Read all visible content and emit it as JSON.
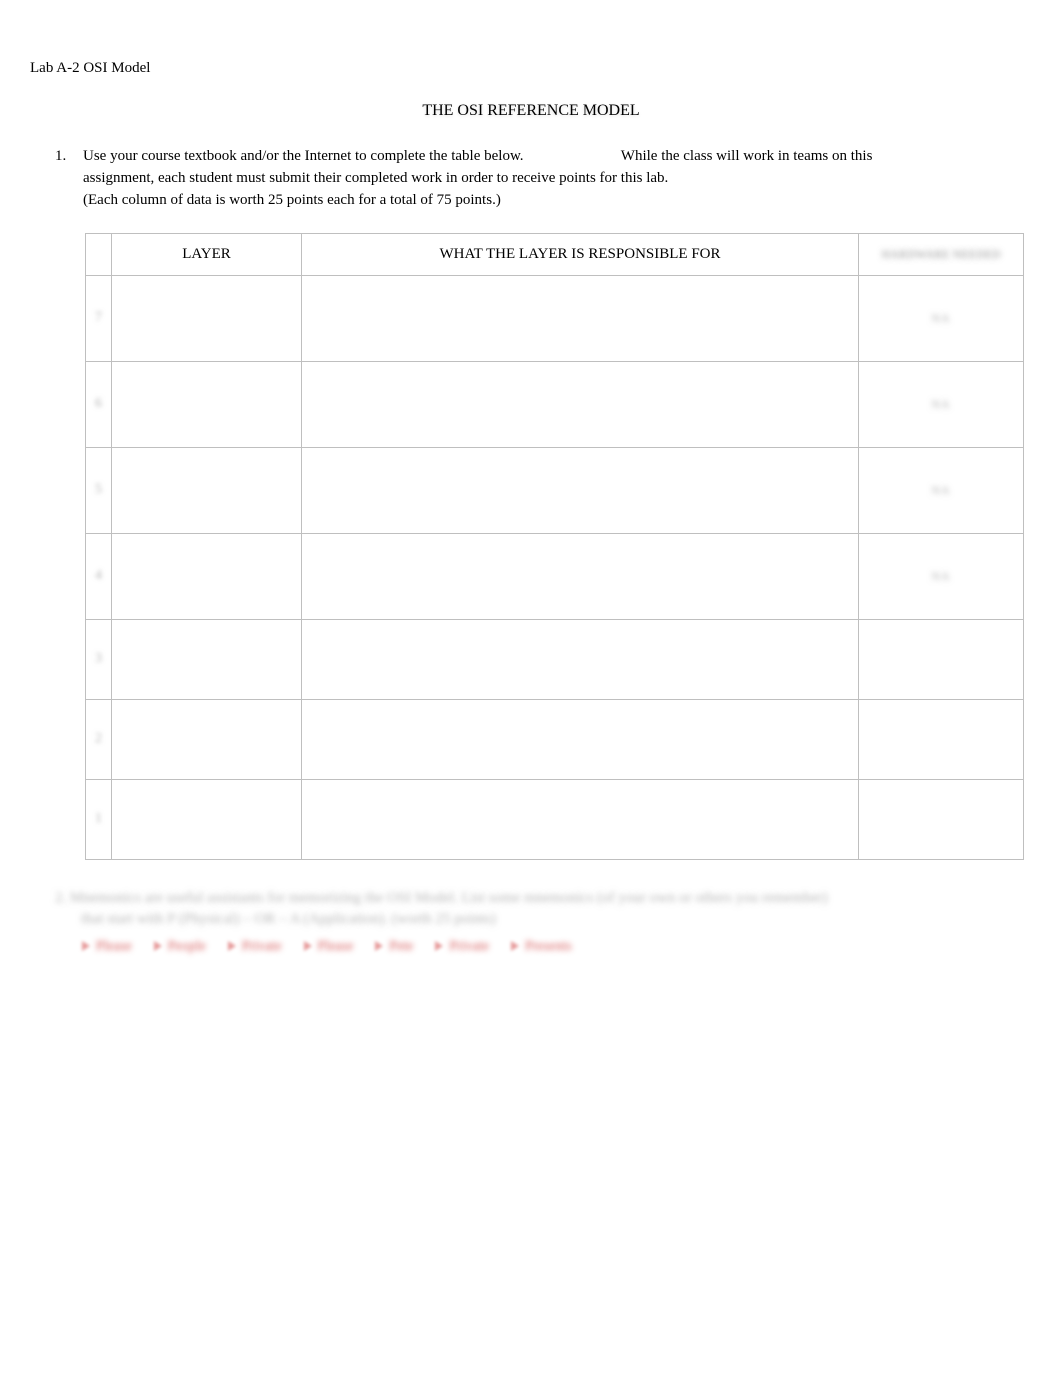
{
  "header": "Lab A-2   OSI Model",
  "title": "THE OSI REFERENCE MODEL",
  "q1": {
    "number": "1.",
    "line1a": "Use your course textbook and/or the Internet to complete the table below.",
    "line1b": "While the class will work in teams on this",
    "line2": "assignment, each student must submit their completed work in order to receive points for this lab.",
    "line3": "(Each column of data is worth 25 points each for a total of 75 points.)"
  },
  "table": {
    "head_layer": "LAYER",
    "head_resp": "WHAT THE LAYER IS RESPONSIBLE FOR",
    "head_hw_blur": "HARDWARE NEEDED",
    "rows": [
      {
        "num": "7",
        "hw": "NA"
      },
      {
        "num": "6",
        "hw": "NA"
      },
      {
        "num": "5",
        "hw": "NA"
      },
      {
        "num": "4",
        "hw": "NA"
      },
      {
        "num": "3",
        "hw": ""
      },
      {
        "num": "2",
        "hw": ""
      },
      {
        "num": "1",
        "hw": ""
      }
    ]
  },
  "q2_blur": "2.   Mnemonics are useful assistants for memorizing the OSI Model. List some mnemonics (of your own or others you remember)",
  "q2_blur2": "that start with P (Physical) – OR – A (Application).   (worth 25 points)",
  "red_words": [
    "Please",
    "People",
    "Private",
    "Please",
    "Pete",
    "Private",
    "Presents"
  ]
}
